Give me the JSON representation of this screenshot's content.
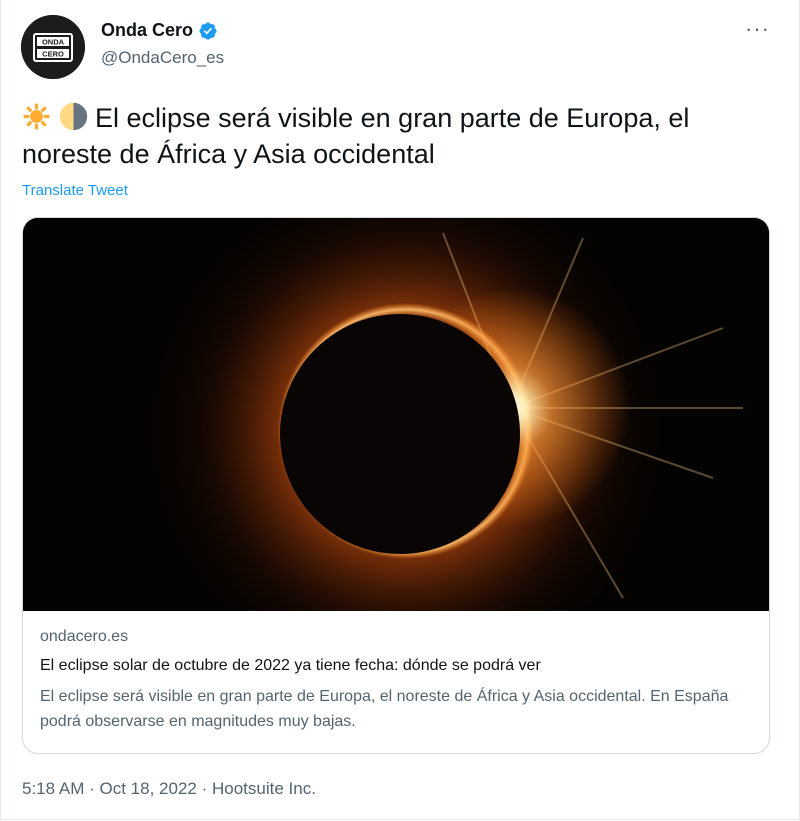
{
  "author": {
    "name": "Onda Cero",
    "handle": "@OndaCero_es",
    "avatar_text": "ONDA CERO",
    "verified_icon": "verified-badge-icon"
  },
  "more_icon": "more-options-icon",
  "more_label": "···",
  "tweet": {
    "emojis": [
      "sun-emoji",
      "half-moon-emoji"
    ],
    "text": "El eclipse será visible en gran parte de Europa, el noreste de África y Asia occidental",
    "translate_label": "Translate Tweet"
  },
  "card": {
    "image": "solar-eclipse-diamond-ring-image",
    "domain": "ondacero.es",
    "title": "El eclipse solar de octubre de 2022 ya tiene fecha: dónde se podrá ver",
    "description": "El eclipse será visible en gran parte de Europa, el noreste de África y Asia occidental. En España podrá observarse en magnitudes muy bajas."
  },
  "meta": {
    "time": "5:18 AM",
    "separator": "·",
    "date": "Oct 18, 2022",
    "source": "Hootsuite Inc."
  },
  "colors": {
    "link": "#1d9bf0",
    "secondary_text": "#536471",
    "primary_text": "#0f1419",
    "border": "#cfd9de"
  }
}
